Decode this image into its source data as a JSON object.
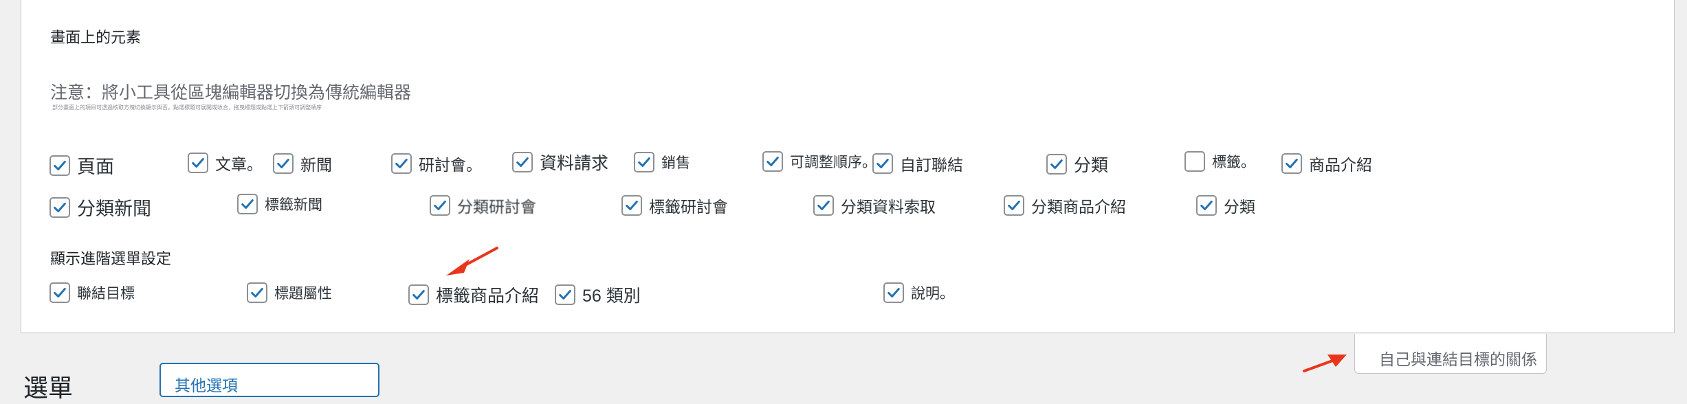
{
  "screen_options": {
    "title": "畫面上的元素",
    "notice": "注意：將小工具從區塊編輯器切換為傳統編輯器",
    "small_note": "部分畫面上的項目可透過核取方塊切換顯示與否。點選標題可展開或收合，拖曳標題或點選上下箭頭可調整順序",
    "boxes_row1": [
      {
        "label": "頁面",
        "checked": true
      },
      {
        "label": "文章。",
        "checked": true
      },
      {
        "label": "新聞",
        "checked": true
      },
      {
        "label": "研討會。",
        "checked": true
      },
      {
        "label": "資料請求",
        "checked": true
      },
      {
        "label": "銷售",
        "checked": true
      },
      {
        "label": "可調整順序。",
        "checked": true
      },
      {
        "label": "自訂聯結",
        "checked": true
      },
      {
        "label": "分類",
        "checked": true
      },
      {
        "label": "標籤。",
        "checked": false
      },
      {
        "label": "商品介紹",
        "checked": true
      }
    ],
    "boxes_row2": [
      {
        "label": "分類新聞",
        "checked": true
      },
      {
        "label": "標籤新聞",
        "checked": true
      },
      {
        "label": "分類研討會",
        "checked": true
      },
      {
        "label": "標籤研討會",
        "checked": true
      },
      {
        "label": "分類資料索取",
        "checked": true
      },
      {
        "label": "分類商品介紹",
        "checked": true
      },
      {
        "label": "分類",
        "checked": true
      }
    ],
    "advanced_title": "顯示進階選單設定",
    "advanced_boxes": [
      {
        "label": "聯結目標",
        "checked": true
      },
      {
        "label": "標題屬性",
        "checked": true
      },
      {
        "label": "標籤商品介紹",
        "checked": true
      },
      {
        "label": "56 類別",
        "checked": true
      },
      {
        "label": "說明。",
        "checked": true
      }
    ]
  },
  "page": {
    "menu_heading": "選單",
    "menu_button": "其他選項",
    "relation_tab": "自己與連結目標的關係"
  },
  "colors": {
    "accent": "#2271b1",
    "arrow": "#e8361e"
  }
}
